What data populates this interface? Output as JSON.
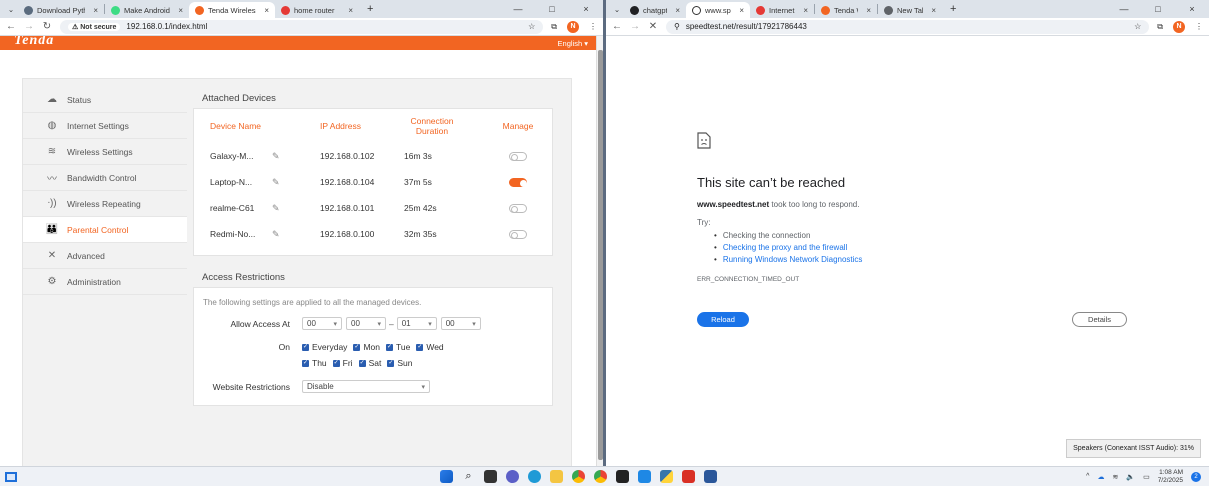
{
  "left_browser": {
    "tabs": [
      {
        "title": "Download Pyth",
        "color": "#5a6b7e"
      },
      {
        "title": "Make Android",
        "color": "#3ddc84"
      },
      {
        "title": "Tenda Wireless",
        "color": "#f26522",
        "active": true
      },
      {
        "title": "home router",
        "color": "#e53935"
      }
    ],
    "new_tab": "+",
    "close": "×",
    "win_controls": [
      "—",
      "□",
      "×"
    ],
    "security_label": "Not secure",
    "url": "192.168.0.1/index.html",
    "profile_initial": "N"
  },
  "tenda": {
    "logo": "Tenda",
    "language": "English",
    "sidebar": [
      {
        "label": "Status",
        "icon": "status-icon",
        "glyph": "☁"
      },
      {
        "label": "Internet Settings",
        "icon": "globe-icon",
        "glyph": "◍"
      },
      {
        "label": "Wireless Settings",
        "icon": "wifi-icon",
        "glyph": "≋"
      },
      {
        "label": "Bandwidth Control",
        "icon": "bandwidth-icon",
        "glyph": "〰"
      },
      {
        "label": "Wireless Repeating",
        "icon": "repeater-icon",
        "glyph": "ᐧ))"
      },
      {
        "label": "Parental Control",
        "icon": "parental-icon",
        "glyph": "👪",
        "active": true
      },
      {
        "label": "Advanced",
        "icon": "tools-icon",
        "glyph": "✕"
      },
      {
        "label": "Administration",
        "icon": "admin-gear-icon",
        "glyph": "⚙"
      }
    ],
    "attached_title": "Attached Devices",
    "columns": {
      "name": "Device Name",
      "ip": "IP Address",
      "duration": "Connection Duration",
      "manage": "Manage"
    },
    "devices": [
      {
        "name": "Galaxy-M...",
        "ip": "192.168.0.102",
        "duration": "16m 3s",
        "managed": false
      },
      {
        "name": "Laptop-N...",
        "ip": "192.168.0.104",
        "duration": "37m 5s",
        "managed": true
      },
      {
        "name": "realme-C61",
        "ip": "192.168.0.101",
        "duration": "25m 42s",
        "managed": false
      },
      {
        "name": "Redmi-No...",
        "ip": "192.168.0.100",
        "duration": "32m 35s",
        "managed": false
      }
    ],
    "access_title": "Access Restrictions",
    "access_note": "The following settings are applied to all the managed devices.",
    "allow_label": "Allow Access At",
    "time": {
      "start_h": "00",
      "start_m": "00",
      "end_h": "01",
      "end_m": "00"
    },
    "on_label": "On",
    "days": [
      "Everyday",
      "Mon",
      "Tue",
      "Wed",
      "Thu",
      "Fri",
      "Sat",
      "Sun"
    ],
    "website_label": "Website Restrictions",
    "website_value": "Disable"
  },
  "right_browser": {
    "tabs": [
      {
        "title": "chatgpt",
        "color": "#202124"
      },
      {
        "title": "www.spe",
        "color": "#ffffff",
        "active": true
      },
      {
        "title": "Internet",
        "color": "#e53935"
      },
      {
        "title": "Tenda W",
        "color": "#f26522"
      },
      {
        "title": "New Tab",
        "color": "#5f6368"
      }
    ],
    "url": "speedtest.net/result/17921786443",
    "profile_initial": "N"
  },
  "error": {
    "title": "This site can’t be reached",
    "host": "www.speedtest.net",
    "message": " took too long to respond.",
    "try": "Try:",
    "suggestions": [
      {
        "text": "Checking the connection",
        "link": false
      },
      {
        "text": "Checking the proxy and the firewall",
        "link": true
      },
      {
        "text": "Running Windows Network Diagnostics",
        "link": true
      }
    ],
    "code": "ERR_CONNECTION_TIMED_OUT",
    "reload": "Reload",
    "details": "Details"
  },
  "toast": "Speakers (Conexant ISST Audio): 31%",
  "taskbar": {
    "time": "1:08 AM",
    "date": "7/2/2025",
    "notifications": "2"
  }
}
